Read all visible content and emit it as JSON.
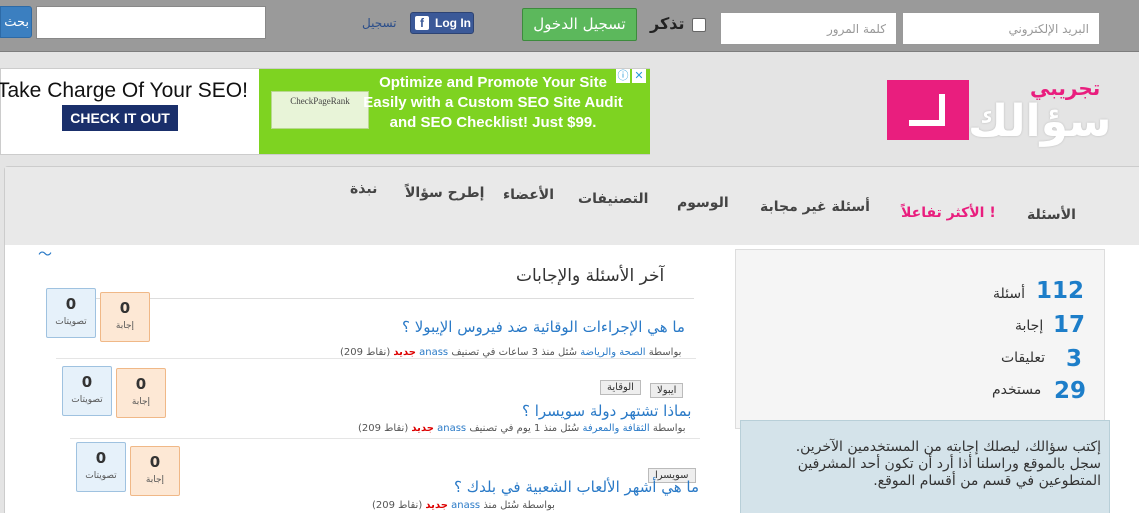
{
  "topbar": {
    "search_button": "بحث",
    "register_link": "تسجيل",
    "facebook_login": "Log In",
    "login_button": "تسجيل الدخول",
    "remember_label": "تذكر",
    "password_placeholder": "كلمة المرور",
    "email_placeholder": "البريد الإلكتروني"
  },
  "ad": {
    "headline": "Take Charge Of Your SEO!",
    "cta": "CHECK IT OUT",
    "logo_text": "CheckPageRank",
    "copy_line1": "Optimize and Promote Your Site",
    "copy_line2": "Easily with a Custom SEO Site Audit",
    "copy_line3": "and SEO Checklist! Just $99.",
    "accent": "#7ed321"
  },
  "logo": {
    "sub": "تجريبي",
    "main": "سؤالك",
    "color": "#e91e7e"
  },
  "nav": {
    "questions": "الأسئلة",
    "hot": "الأكثر تفاعلاً !",
    "unanswered": "أسئلة غير مجابة",
    "tags": "الوسوم",
    "categories": "التصنيفات",
    "members": "الأعضاء",
    "ask": "إطرح سؤالاً",
    "about": "نبذة"
  },
  "section_title": "آخر الأسئلة والإجابات",
  "questions": [
    {
      "title": "ما هي الإجراءات الوقائية ضد فيروس الإيبولا ؟",
      "meta_prefix": "سُئل منذ 3 ساعات في تصنيف",
      "category": "الصحة والرياضة",
      "by": "بواسطة",
      "user": "anass",
      "badge": "جديد",
      "points": "(209 نقاط)",
      "votes": "0",
      "votes_label": "تصويتات",
      "answers": "0",
      "answers_label": "إجابة",
      "tags": [
        "ايبولا",
        "الوقاية"
      ]
    },
    {
      "title": "بماذا تشتهر دولة سويسرا ؟",
      "meta_prefix": "سُئل منذ 1 يوم في تصنيف",
      "category": "الثقافة والمعرفة",
      "by": "بواسطة",
      "user": "anass",
      "badge": "جديد",
      "points": "(209 نقاط)",
      "votes": "0",
      "votes_label": "تصويتات",
      "answers": "0",
      "answers_label": "إجابة",
      "tags": [
        "سويسرا"
      ]
    },
    {
      "title": "ما هي أشهر الألعاب الشعبية في بلدك ؟",
      "meta_prefix": "سُئل منذ",
      "category": "",
      "by": "بواسطة",
      "user": "anass",
      "badge": "جديد",
      "points": "(209 نقاط)",
      "votes": "0",
      "votes_label": "تصويتات",
      "answers": "0",
      "answers_label": "إجابة",
      "tags": []
    }
  ],
  "stats": [
    {
      "num": "112",
      "label": "أسئلة"
    },
    {
      "num": "17",
      "label": "إجابة"
    },
    {
      "num": "3",
      "label": "تعليقات"
    },
    {
      "num": "29",
      "label": "مستخدم"
    }
  ],
  "welcome": "إكتب سؤالك، ليصلك إجابته من المستخدمين الآخرين. سجل بالموقع وراسلنا أذا أرد أن تكون أحد المشرفين المتطوعين في قسم من أقسام الموقع."
}
